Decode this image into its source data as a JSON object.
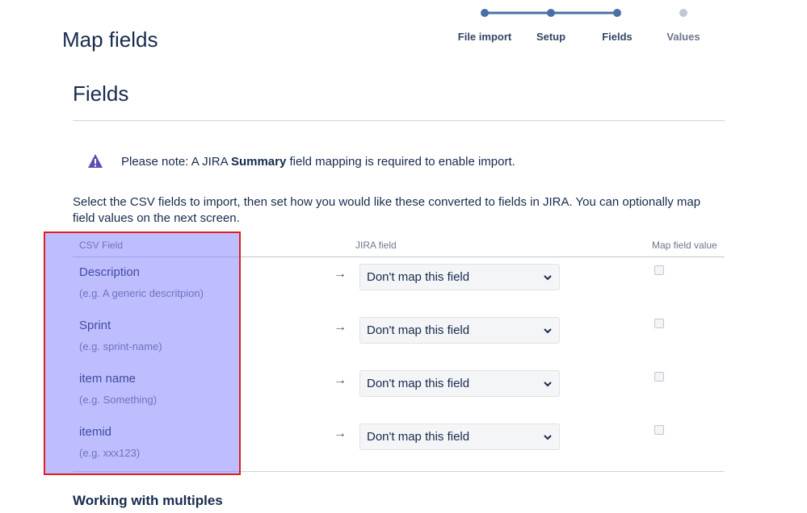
{
  "page": {
    "title": "Map fields"
  },
  "stepper": {
    "steps": [
      {
        "label": "File import",
        "state": "done"
      },
      {
        "label": "Setup",
        "state": "done"
      },
      {
        "label": "Fields",
        "state": "current"
      },
      {
        "label": "Values",
        "state": "upcoming"
      }
    ],
    "active_color": "#4a6fa5",
    "inactive_color": "#c1c7d0"
  },
  "section": {
    "title": "Fields"
  },
  "note": {
    "prefix": "Please note: A JIRA ",
    "bold": "Summary",
    "suffix": " field mapping is required to enable import.",
    "icon": "warning-icon"
  },
  "intro": "Select the CSV fields to import, then set how you would like these converted to fields in JIRA. You can optionally map field values on the next screen.",
  "table": {
    "headers": {
      "csv_field": "CSV Field",
      "jira_field": "JIRA field",
      "map_value": "Map field value"
    },
    "arrow": "→",
    "rows": [
      {
        "name": "Description",
        "example": "(e.g.  A generic descritpion)",
        "selected": "Don't map this field",
        "map_value_checked": false
      },
      {
        "name": "Sprint",
        "example": "(e.g.  sprint-name)",
        "selected": "Don't map this field",
        "map_value_checked": false
      },
      {
        "name": "item name",
        "example": "(e.g.  Something)",
        "selected": "Don't map this field",
        "map_value_checked": false
      },
      {
        "name": "itemid",
        "example": "(e.g.  xxx123)",
        "selected": "Don't map this field",
        "map_value_checked": false
      }
    ]
  },
  "subsection": {
    "title": "Working with multiples"
  },
  "highlight_color": "#e01e1e"
}
